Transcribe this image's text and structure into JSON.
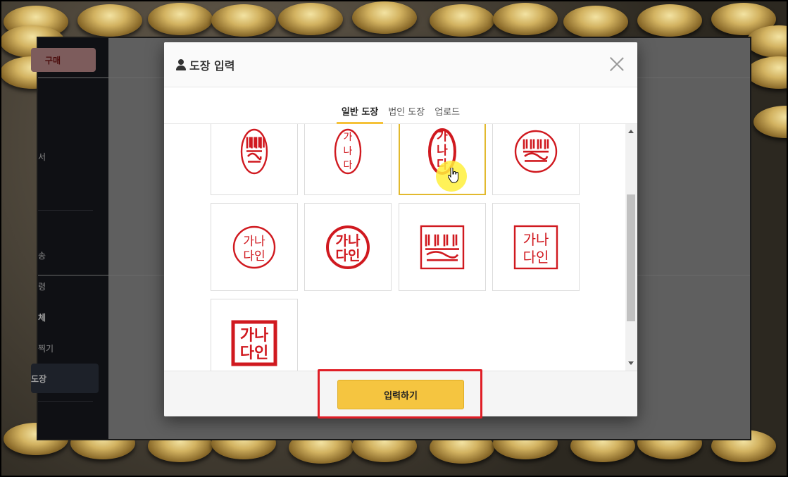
{
  "colors": {
    "accent": "#f5c540",
    "stamp_red": "#d0191f",
    "highlight": "#e01e26"
  },
  "sidebar": {
    "buy_label": "구매",
    "items": [
      "서",
      "송",
      "령",
      "체",
      "찍기"
    ],
    "active_label": "도장"
  },
  "modal": {
    "icon": "user-icon",
    "title": "도장 입력",
    "close_icon": "close-icon",
    "tabs": [
      {
        "label": "일반 도장",
        "active": true
      },
      {
        "label": "법인 도장",
        "active": false
      },
      {
        "label": "업로드",
        "active": false
      }
    ],
    "stamps": [
      {
        "name": "oval-seal-script-stamp",
        "lines": []
      },
      {
        "name": "oval-vertical-thin-stamp",
        "lines": [
          "가",
          "나",
          "다"
        ]
      },
      {
        "name": "oval-vertical-bold-stamp",
        "lines": [
          "가",
          "나",
          "다"
        ],
        "selected": true
      },
      {
        "name": "round-seal-script-stamp",
        "lines": []
      },
      {
        "name": "round-thin-stamp",
        "lines": [
          "가나",
          "다인"
        ]
      },
      {
        "name": "round-bold-stamp",
        "lines": [
          "가나",
          "다인"
        ]
      },
      {
        "name": "square-seal-script-stamp",
        "lines": []
      },
      {
        "name": "square-thin-stamp",
        "lines": [
          "가나",
          "다인"
        ]
      },
      {
        "name": "square-bold-stamp",
        "lines": [
          "가나",
          "다인"
        ]
      }
    ],
    "submit_label": "입력하기"
  }
}
